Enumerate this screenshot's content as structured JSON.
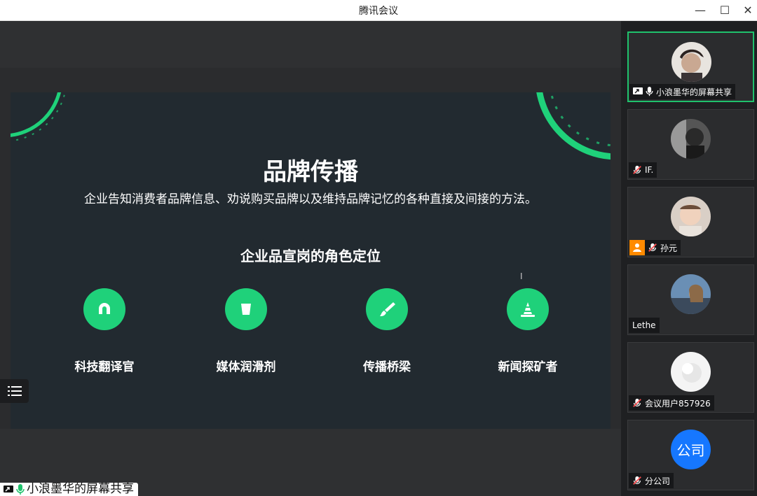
{
  "window": {
    "title": "腾讯会议",
    "minimize": "—",
    "maximize": "☐",
    "close": "✕"
  },
  "slide": {
    "title": "品牌传播",
    "subtitle": "企业告知消费者品牌信息、劝说购买品牌以及维持品牌记忆的各种直接及间接的方法。",
    "section": "企业品宣岗的角色定位",
    "roles": [
      {
        "label": "科技翻译官",
        "icon": "magnet-icon"
      },
      {
        "label": "媒体润滑剂",
        "icon": "cup-icon"
      },
      {
        "label": "传播桥梁",
        "icon": "brush-icon"
      },
      {
        "label": "新闻探矿者",
        "icon": "cone-icon"
      }
    ],
    "accent": "#1fd17a"
  },
  "screen_share_label": "小浪墨华的屏幕共享",
  "participants": [
    {
      "name": "小浪墨华的屏幕共享",
      "mic": "on",
      "screen_share": true,
      "active": true
    },
    {
      "name": "IF.",
      "mic": "muted"
    },
    {
      "name": "孙元",
      "mic": "muted",
      "host_badge": true
    },
    {
      "name": "Lethe",
      "mic": "none"
    },
    {
      "name": "会议用户857926",
      "mic": "muted"
    },
    {
      "name": "分公司",
      "mic": "muted",
      "avatar_text": "公司",
      "avatar_color": "#1677ff"
    }
  ]
}
